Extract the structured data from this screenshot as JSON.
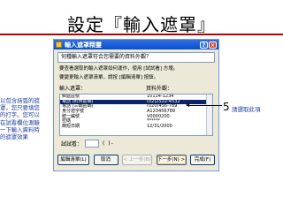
{
  "slide": {
    "title": "設定『輸入遮罩』"
  },
  "dialog": {
    "title": "輸入遮罩精靈",
    "instruction_box": "何種輸入遮罩符合您需要的資料外觀？",
    "instruction_1": "要查看選取的輸入遮罩如何運作，使用 [試試看] 方塊。",
    "instruction_2": "要變更輸入遮罩清單，請按 [編輯清單] 按鈕。",
    "col_mask": "輸入遮罩：",
    "col_data": "資料外觀：",
    "rows": [
      {
        "mask": "郵遞區號",
        "data": "10114-1234"
      },
      {
        "mask": "電話 (附帶區碼)",
        "data": "(02)2522-4532",
        "selected": true
      },
      {
        "mask": "電話 (三碼區碼)",
        "data": "(020)456-789"
      },
      {
        "mask": "身分證字號",
        "data": "A123456789"
      },
      {
        "mask": "統一編號",
        "data": "V0000200"
      },
      {
        "mask": "密碼",
        "data": "******"
      },
      {
        "mask": "簡短日期",
        "data": "12/31/2000"
      }
    ],
    "try_label": "試試看：",
    "try_hint": "(   )-",
    "buttons": {
      "edit_list": "編輯清單(L)",
      "cancel": "取消",
      "back": "< 上一步(B)",
      "next": "下一步(N) >",
      "finish": "完成(F)"
    }
  },
  "annotations": {
    "left_note": "以包含括弧的遮罩，您只要填您的打字。您可以在試看欄位測驗一下輸入資料時的遮罩效果",
    "step_number": "5",
    "step_note": "請選取此項"
  }
}
